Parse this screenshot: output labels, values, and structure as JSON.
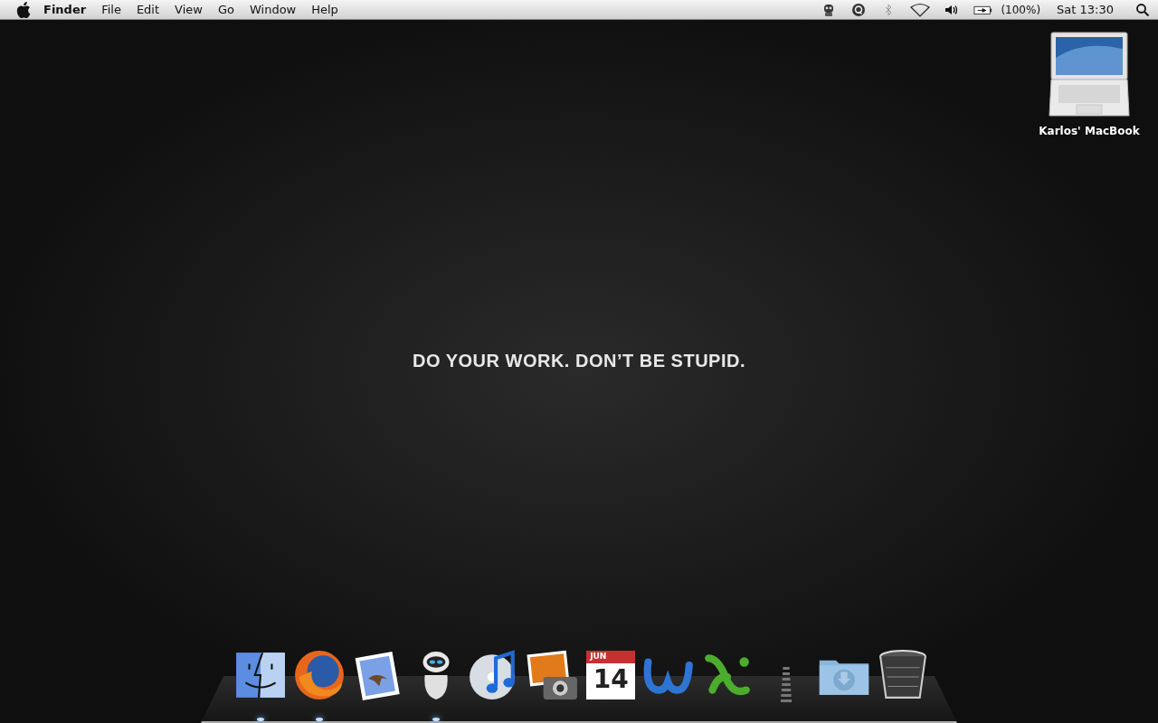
{
  "menu_bar": {
    "menus": [
      {
        "label": "Finder",
        "kind": "app"
      },
      {
        "label": "File",
        "kind": "menu"
      },
      {
        "label": "Edit",
        "kind": "menu"
      },
      {
        "label": "View",
        "kind": "menu"
      },
      {
        "label": "Go",
        "kind": "menu"
      },
      {
        "label": "Window",
        "kind": "menu"
      },
      {
        "label": "Help",
        "kind": "menu"
      }
    ],
    "battery": "(100%)",
    "clock": "Sat 13:30"
  },
  "desktop": {
    "wallpaper_text": "DO YOUR WORK. DON’T BE STUPID.",
    "icons": [
      {
        "label": "Karlos' MacBook"
      }
    ]
  },
  "dock": {
    "items": [
      {
        "kind": "finder",
        "running": true
      },
      {
        "kind": "firefox",
        "running": true
      },
      {
        "kind": "mail",
        "running": false
      },
      {
        "kind": "robot",
        "running": true
      },
      {
        "kind": "music",
        "running": false
      },
      {
        "kind": "photos",
        "running": false
      },
      {
        "kind": "calendar",
        "running": false,
        "month": "JUN",
        "day": "14"
      },
      {
        "kind": "word",
        "running": false
      },
      {
        "kind": "excel",
        "running": false
      },
      {
        "kind": "separator"
      },
      {
        "kind": "folder",
        "running": false
      },
      {
        "kind": "trash",
        "running": false
      }
    ]
  }
}
